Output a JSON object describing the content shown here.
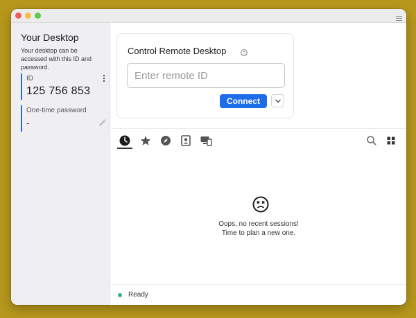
{
  "window": {
    "traffic_lights": [
      "close",
      "minimize",
      "zoom"
    ],
    "menu_icon": "hamburger-icon"
  },
  "sidebar": {
    "title": "Your Desktop",
    "description": "Your desktop can be accessed with this ID and password.",
    "id_label": "ID",
    "id_value": "125 756 853",
    "password_label": "One-time password",
    "password_value": "-"
  },
  "connect_card": {
    "title": "Control Remote Desktop",
    "input_placeholder": "Enter remote ID",
    "input_value": "",
    "connect_label": "Connect"
  },
  "tabs": [
    {
      "name": "recent-sessions",
      "icon": "clock-icon",
      "active": true
    },
    {
      "name": "favorites",
      "icon": "star-icon",
      "active": false
    },
    {
      "name": "discovered",
      "icon": "compass-icon",
      "active": false
    },
    {
      "name": "address-book",
      "icon": "contact-card-icon",
      "active": false
    },
    {
      "name": "devices",
      "icon": "devices-icon",
      "active": false
    }
  ],
  "tools": [
    "search-icon",
    "grid-view-icon"
  ],
  "empty_state": {
    "icon": "sad-face-icon",
    "line1": "Oops, no recent sessions!",
    "line2": "Time to plan a new one."
  },
  "status": {
    "text": "Ready",
    "color": "#36b37e"
  },
  "colors": {
    "accent": "#1d6ce9",
    "background": "#b8981c",
    "sidebar": "#efeff2"
  }
}
